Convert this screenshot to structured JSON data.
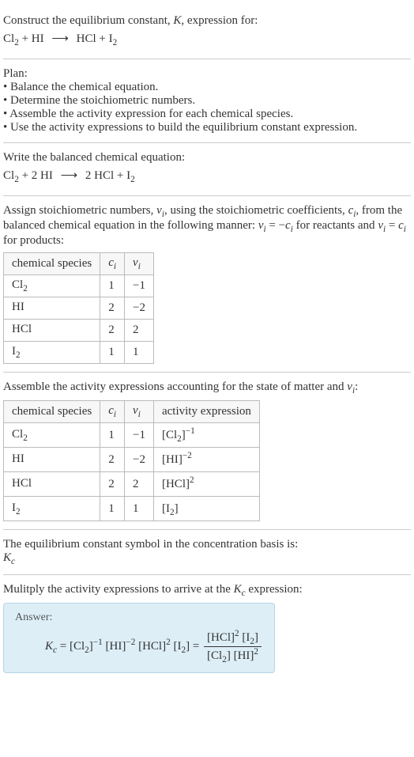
{
  "header": {
    "prompt": "Construct the equilibrium constant, K, expression for:",
    "eq_lhs1": "Cl",
    "eq_lhs1_sub": "2",
    "plus1": " + HI ",
    "arrow": "⟶",
    "eq_rhs": " HCl + I",
    "eq_rhs_sub": "2"
  },
  "plan": {
    "title": "Plan:",
    "b1": "• Balance the chemical equation.",
    "b2": "• Determine the stoichiometric numbers.",
    "b3": "• Assemble the activity expression for each chemical species.",
    "b4": "• Use the activity expressions to build the equilibrium constant expression."
  },
  "balanced": {
    "intro": "Write the balanced chemical equation:",
    "l1": "Cl",
    "l1s": "2",
    "mid": " + 2 HI ",
    "arrow": "⟶",
    "r": " 2 HCl + I",
    "rs": "2"
  },
  "stoich": {
    "intro1": "Assign stoichiometric numbers, ",
    "nu": "ν",
    "nu_sub": "i",
    "intro2": ", using the stoichiometric coefficients, ",
    "c": "c",
    "c_sub": "i",
    "intro3": ", from the balanced chemical equation in the following manner: ",
    "rel1a": "ν",
    "rel1b": "i",
    "rel1c": " = −",
    "rel1d": "c",
    "rel1e": "i",
    "intro4": " for reactants and ",
    "rel2a": "ν",
    "rel2b": "i",
    "rel2c": " = ",
    "rel2d": "c",
    "rel2e": "i",
    "intro5": " for products:",
    "headers": {
      "h1": "chemical species",
      "h2": "c",
      "h2s": "i",
      "h3": "ν",
      "h3s": "i"
    },
    "rows": [
      {
        "sp": "Cl",
        "sps": "2",
        "ci": "1",
        "vi": "−1"
      },
      {
        "sp": "HI",
        "sps": "",
        "ci": "2",
        "vi": "−2"
      },
      {
        "sp": "HCl",
        "sps": "",
        "ci": "2",
        "vi": "2"
      },
      {
        "sp": "I",
        "sps": "2",
        "ci": "1",
        "vi": "1"
      }
    ]
  },
  "activity": {
    "intro1": "Assemble the activity expressions accounting for the state of matter and ",
    "nu": "ν",
    "nus": "i",
    "intro2": ":",
    "headers": {
      "h1": "chemical species",
      "h2": "c",
      "h2s": "i",
      "h3": "ν",
      "h3s": "i",
      "h4": "activity expression"
    },
    "rows": [
      {
        "sp": "Cl",
        "sps": "2",
        "ci": "1",
        "vi": "−1",
        "ae_b": "[Cl",
        "ae_bs": "2",
        "ae_c": "]",
        "ae_exp": "−1"
      },
      {
        "sp": "HI",
        "sps": "",
        "ci": "2",
        "vi": "−2",
        "ae_b": "[HI",
        "ae_bs": "",
        "ae_c": "]",
        "ae_exp": "−2"
      },
      {
        "sp": "HCl",
        "sps": "",
        "ci": "2",
        "vi": "2",
        "ae_b": "[HCl",
        "ae_bs": "",
        "ae_c": "]",
        "ae_exp": "2"
      },
      {
        "sp": "I",
        "sps": "2",
        "ci": "1",
        "vi": "1",
        "ae_b": "[I",
        "ae_bs": "2",
        "ae_c": "]",
        "ae_exp": ""
      }
    ]
  },
  "symbol": {
    "line": "The equilibrium constant symbol in the concentration basis is:",
    "K": "K",
    "Ks": "c"
  },
  "multiply": {
    "line1": "Mulitply the activity expressions to arrive at the ",
    "K": "K",
    "Ks": "c",
    "line2": " expression:"
  },
  "answer": {
    "label": "Answer:",
    "K": "K",
    "Ks": "c",
    "eq": " = ",
    "t1": "[Cl",
    "t1s": "2",
    "t1c": "]",
    "t1e": "−1",
    "t2": " [HI]",
    "t2e": "−2",
    "t3": " [HCl]",
    "t3e": "2",
    "t4": " [I",
    "t4s": "2",
    "t4c": "] = ",
    "num1": "[HCl]",
    "num1e": "2",
    "num2": " [I",
    "num2s": "2",
    "num2c": "]",
    "den1": "[Cl",
    "den1s": "2",
    "den1c": "] [HI]",
    "den1e": "2"
  },
  "chart_data": {
    "type": "table",
    "tables": [
      {
        "title": "stoichiometric numbers",
        "columns": [
          "chemical species",
          "c_i",
          "ν_i"
        ],
        "rows": [
          [
            "Cl2",
            1,
            -1
          ],
          [
            "HI",
            2,
            -2
          ],
          [
            "HCl",
            2,
            2
          ],
          [
            "I2",
            1,
            1
          ]
        ]
      },
      {
        "title": "activity expressions",
        "columns": [
          "chemical species",
          "c_i",
          "ν_i",
          "activity expression"
        ],
        "rows": [
          [
            "Cl2",
            1,
            -1,
            "[Cl2]^-1"
          ],
          [
            "HI",
            2,
            -2,
            "[HI]^-2"
          ],
          [
            "HCl",
            2,
            2,
            "[HCl]^2"
          ],
          [
            "I2",
            1,
            1,
            "[I2]"
          ]
        ]
      }
    ]
  }
}
